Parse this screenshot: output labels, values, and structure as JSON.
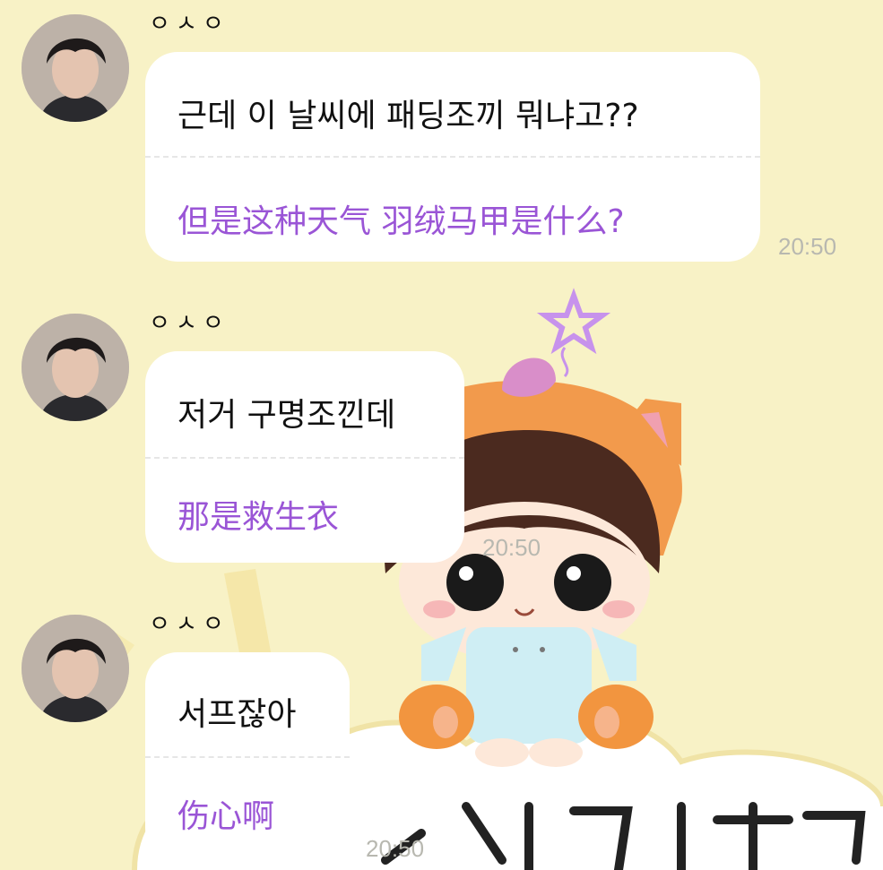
{
  "messages": [
    {
      "sender": "ㅇㅅㅇ",
      "korean": "근데 이 날씨에 패딩조끼 뭐냐고??",
      "chinese": "但是这种天气 羽绒马甲是什么?",
      "time": "20:50"
    },
    {
      "sender": "ㅇㅅㅇ",
      "korean": "저거 구명조낀데",
      "chinese": "那是救生衣",
      "time": "20:50"
    },
    {
      "sender": "ㅇㅅㅇ",
      "korean": "서프잖아",
      "chinese": "伤心啊",
      "time": "20:50"
    }
  ],
  "colors": {
    "background": "#f8f2c6",
    "bubble": "#ffffff",
    "translation_text": "#9a55d6",
    "time_text": "#b8b8b0"
  },
  "icons": [
    "avatar-photo",
    "chibi-sticker-art"
  ]
}
